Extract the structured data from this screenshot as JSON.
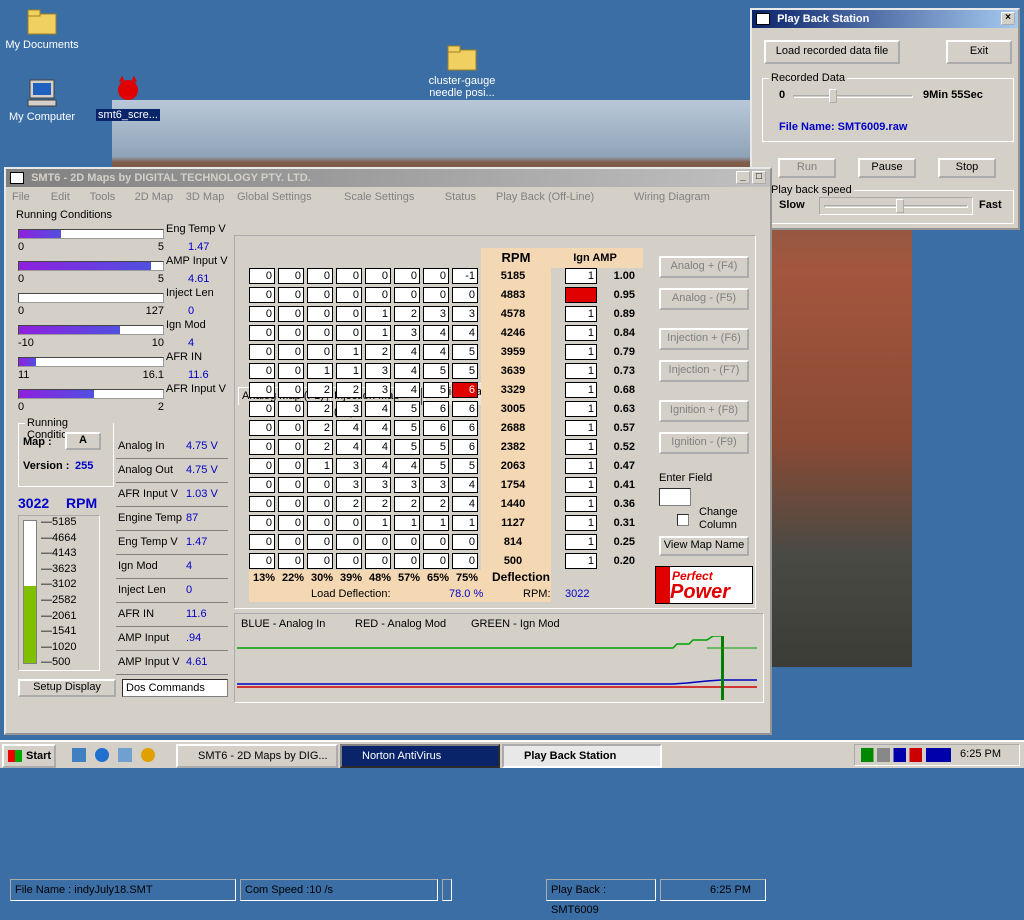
{
  "desktop": {
    "icons": [
      {
        "label": "My Documents"
      },
      {
        "label": "My Computer"
      },
      {
        "label": "smt6_scre..."
      },
      {
        "label": "cluster-gauge needle posi..."
      }
    ]
  },
  "playback": {
    "title": "Play Back Station",
    "load_label": "Load recorded data file",
    "exit_label": "Exit",
    "recorded_label": "Recorded Data",
    "start_value": "0",
    "end_value": "9Min 55Sec",
    "position_pct": 0.3,
    "file_name": "File Name: SMT6009.raw",
    "run_label": "Run",
    "pause_label": "Pause",
    "stop_label": "Stop",
    "speed_label": "Play back speed",
    "slow_label": "Slow",
    "fast_label": "Fast",
    "speed_pct": 0.5
  },
  "main": {
    "title": "SMT6 - 2D Maps   by  DIGITAL TECHNOLOGY PTY. LTD.",
    "menu": [
      "File",
      "Edit",
      "Tools",
      "2D Map",
      "3D Map",
      "Global Settings",
      "Scale Settings",
      "Status",
      "Play Back (Off-Line)",
      "Wiring Diagram"
    ],
    "running_conditions_label": "Running Conditions",
    "gauges": [
      {
        "label": "Eng Temp V",
        "min": "0",
        "max": "5",
        "value": "1.47",
        "frac": 0.29
      },
      {
        "label": "AMP Input V",
        "min": "0",
        "max": "5",
        "value": "4.61",
        "frac": 0.92
      },
      {
        "label": "Inject Len",
        "min": "0",
        "max": "127",
        "value": "0",
        "frac": 0
      },
      {
        "label": "Ign Mod",
        "min": "-10",
        "max": "10",
        "value": "4",
        "frac": 0.7
      },
      {
        "label": "AFR IN",
        "min": "11",
        "max": "16.1",
        "value": "11.6",
        "frac": 0.12
      },
      {
        "label": "AFR Input V",
        "min": "0",
        "max": "2",
        "value": "",
        "frac": 0.52
      }
    ],
    "running_condition_label": "Running Condition",
    "map_label": "Map :",
    "map_value": "A",
    "version_label": "Version :",
    "version_value": "255",
    "rpm_value": "3022",
    "rpm_unit": "RPM",
    "rpm_scale": [
      "5185",
      "4664",
      "4143",
      "3623",
      "3102",
      "2582",
      "2061",
      "1541",
      "1020",
      "500"
    ],
    "rpm_level_pct": 0.54,
    "readings": [
      {
        "label": "Analog In",
        "value": "4.75 V"
      },
      {
        "label": "Analog Out",
        "value": "4.75 V"
      },
      {
        "label": "AFR Input V",
        "value": "1.03 V"
      },
      {
        "label": "Engine Temp",
        "value": "87"
      },
      {
        "label": "Eng Temp V",
        "value": "1.47"
      },
      {
        "label": "Ign Mod",
        "value": "4"
      },
      {
        "label": "Inject Len",
        "value": "0"
      },
      {
        "label": "AFR IN",
        "value": "11.6"
      },
      {
        "label": "AMP Input",
        "value": ".94"
      },
      {
        "label": "AMP Input V",
        "value": "4.61"
      }
    ],
    "setup_label": "Setup Display",
    "dos_label": "Dos Commands",
    "tabs": [
      "Analog Map (F1)",
      "Injection Map (F2)",
      "Ignition Map (F3)"
    ],
    "rpm_header": "RPM",
    "ign_amp_header": "Ign AMP",
    "rpm_rows": [
      "5185",
      "4883",
      "4578",
      "4246",
      "3959",
      "3639",
      "3329",
      "3005",
      "2688",
      "2382",
      "2063",
      "1754",
      "1440",
      "1127",
      "814",
      "500"
    ],
    "grid": [
      [
        0,
        0,
        0,
        0,
        0,
        0,
        0,
        -1
      ],
      [
        0,
        0,
        0,
        0,
        0,
        0,
        0,
        0
      ],
      [
        0,
        0,
        0,
        0,
        1,
        2,
        3,
        3
      ],
      [
        0,
        0,
        0,
        0,
        1,
        3,
        4,
        4
      ],
      [
        0,
        0,
        0,
        1,
        2,
        4,
        4,
        5
      ],
      [
        0,
        0,
        1,
        1,
        3,
        4,
        5,
        5
      ],
      [
        0,
        0,
        2,
        2,
        3,
        4,
        5,
        6
      ],
      [
        0,
        0,
        2,
        3,
        4,
        5,
        6,
        6
      ],
      [
        0,
        0,
        2,
        4,
        4,
        5,
        6,
        6
      ],
      [
        0,
        0,
        2,
        4,
        4,
        5,
        5,
        6
      ],
      [
        0,
        0,
        1,
        3,
        4,
        4,
        5,
        5
      ],
      [
        0,
        0,
        0,
        3,
        3,
        3,
        3,
        4
      ],
      [
        0,
        0,
        0,
        2,
        2,
        2,
        2,
        4
      ],
      [
        0,
        0,
        0,
        0,
        1,
        1,
        1,
        1
      ],
      [
        0,
        0,
        0,
        0,
        0,
        0,
        0,
        0
      ],
      [
        0,
        0,
        0,
        0,
        0,
        0,
        0,
        0
      ]
    ],
    "red_cell": {
      "row": 6,
      "col": 7
    },
    "amp_values": [
      "1",
      "",
      "1",
      "1",
      "1",
      "1",
      "1",
      "1",
      "1",
      "1",
      "1",
      "1",
      "1",
      "1",
      "1",
      "1"
    ],
    "amp_red_row": 1,
    "amp_factors": [
      "1.00",
      "0.95",
      "0.89",
      "0.84",
      "0.79",
      "0.73",
      "0.68",
      "0.63",
      "0.57",
      "0.52",
      "0.47",
      "0.41",
      "0.36",
      "0.31",
      "0.25",
      "0.20"
    ],
    "deflections": [
      "13%",
      "22%",
      "30%",
      "39%",
      "48%",
      "57%",
      "65%",
      "75%"
    ],
    "deflection_label": "Deflection",
    "load_deflection_label": "Load Deflection:",
    "load_deflection_value": "78.0 %",
    "rpm_label": "RPM:",
    "rpm_footer_value": "3022",
    "side_buttons": [
      "Analog + (F4)",
      "Analog - (F5)",
      "Injection + (F6)",
      "Injection - (F7)",
      "Ignition + (F8)",
      "Ignition - (F9)"
    ],
    "enter_field_label": "Enter Field",
    "change_column_label": "Change Column",
    "view_map_label": "View Map Name",
    "logo_line1": "Perfect",
    "logo_line2": "Power",
    "legend": [
      "BLUE - Analog In",
      "RED - Analog Mod",
      "GREEN - Ign Mod"
    ],
    "status": {
      "file": "File Name : indyJuly18.SMT",
      "com": "Com Speed :10 /s",
      "playback": "Play Back : SMT6009",
      "time": "6:25 PM"
    }
  },
  "taskbar": {
    "start": "Start",
    "items": [
      "SMT6 - 2D Maps   by  DIG...",
      "Norton AntiVirus",
      "Play Back Station"
    ],
    "time": "6:25 PM"
  },
  "chart_data": {
    "type": "line",
    "series": [
      {
        "name": "BLUE - Analog In",
        "color": "#0000c0"
      },
      {
        "name": "RED - Analog Mod",
        "color": "#d00000"
      },
      {
        "name": "GREEN - Ign Mod",
        "color": "#00a000"
      }
    ]
  }
}
